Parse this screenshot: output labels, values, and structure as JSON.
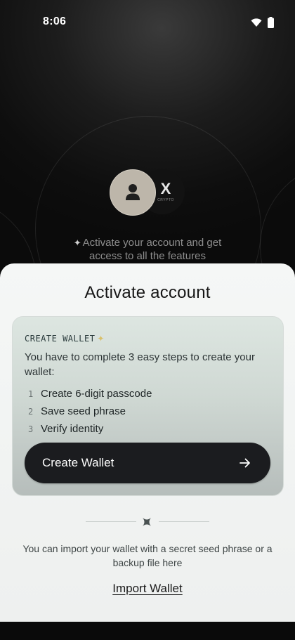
{
  "status_bar": {
    "time": "8:06",
    "icons": [
      "wifi-icon",
      "battery-icon"
    ]
  },
  "hero": {
    "brand_logo_text": "X",
    "brand_logo_subtext": "CRYPTO",
    "promo_text": "Activate your account and get access to all the features"
  },
  "sheet": {
    "title": "Activate account",
    "card": {
      "kicker": "CREATE WALLET",
      "description": "You have to complete 3 easy steps to create your wallet:",
      "steps": [
        {
          "number": "1",
          "label": "Create 6-digit passcode"
        },
        {
          "number": "2",
          "label": "Save seed phrase"
        },
        {
          "number": "3",
          "label": "Verify identity"
        }
      ],
      "button_label": "Create Wallet"
    },
    "import_text": "You can import your wallet with a secret seed phrase or a backup file here",
    "import_link": "Import Wallet"
  },
  "colors": {
    "background": "#0d0d0d",
    "sheet": "#f5f7f6",
    "card_top": "#dde6e1",
    "button": "#1b1c1f",
    "sparkle_accent": "#d9c06a"
  }
}
